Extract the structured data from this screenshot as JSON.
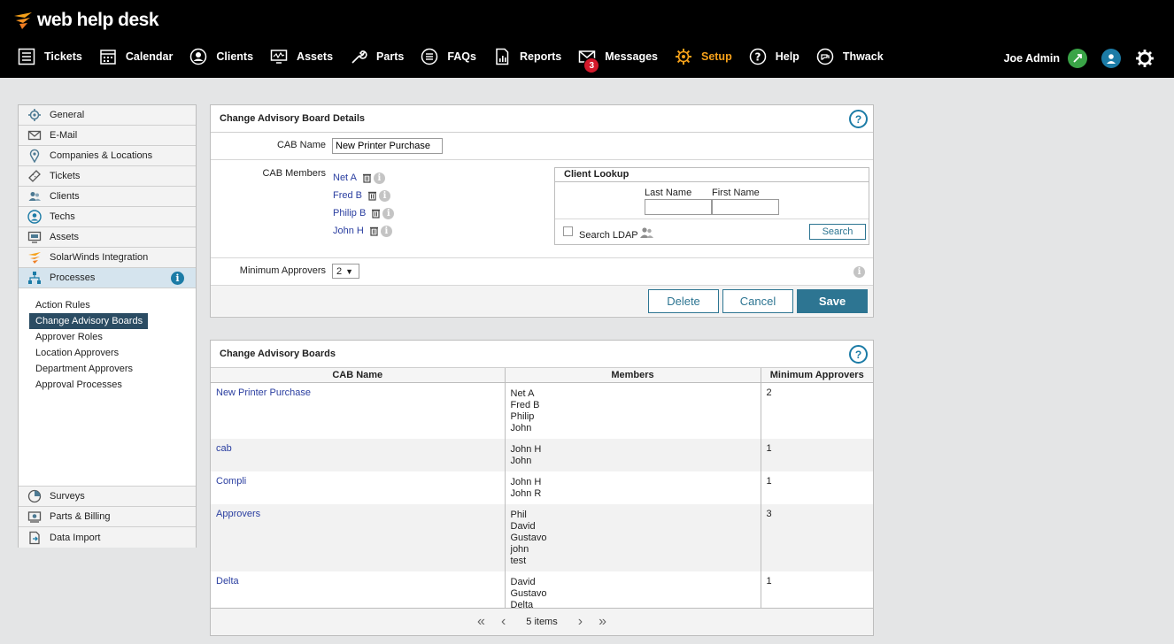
{
  "header": {
    "logo_text": "web help desk",
    "nav": [
      {
        "label": "Tickets",
        "icon": "list-icon"
      },
      {
        "label": "Calendar",
        "icon": "calendar-icon"
      },
      {
        "label": "Clients",
        "icon": "person-icon"
      },
      {
        "label": "Assets",
        "icon": "monitor-icon"
      },
      {
        "label": "Parts",
        "icon": "wrench-icon"
      },
      {
        "label": "FAQs",
        "icon": "faq-icon"
      },
      {
        "label": "Reports",
        "icon": "report-icon"
      },
      {
        "label": "Messages",
        "icon": "envelope-icon",
        "badge": "3"
      },
      {
        "label": "Setup",
        "icon": "gear-icon",
        "active": true
      },
      {
        "label": "Help",
        "icon": "question-icon"
      },
      {
        "label": "Thwack",
        "icon": "thwack-icon"
      }
    ],
    "user_name": "Joe Admin"
  },
  "sidebar": {
    "items": [
      {
        "label": "General"
      },
      {
        "label": "E-Mail"
      },
      {
        "label": "Companies & Locations"
      },
      {
        "label": "Tickets"
      },
      {
        "label": "Clients"
      },
      {
        "label": "Techs"
      },
      {
        "label": "Assets"
      },
      {
        "label": "SolarWinds Integration"
      },
      {
        "label": "Processes",
        "info": "i"
      }
    ],
    "subitems": [
      {
        "label": "Action Rules"
      },
      {
        "label": "Change Advisory Boards",
        "active": true
      },
      {
        "label": "Approver Roles"
      },
      {
        "label": "Location Approvers"
      },
      {
        "label": "Department Approvers"
      },
      {
        "label": "Approval Processes"
      }
    ],
    "bottom_items": [
      {
        "label": "Surveys"
      },
      {
        "label": "Parts & Billing"
      },
      {
        "label": "Data Import"
      }
    ]
  },
  "details": {
    "title": "Change Advisory Board Details",
    "help": "?",
    "cab_name_label": "CAB Name",
    "cab_name_value": "New Printer Purchase",
    "members_label": "CAB Members",
    "members": [
      "Net A",
      "Fred B",
      "Philip B",
      "John H"
    ],
    "lookup": {
      "title": "Client Lookup",
      "last_name_label": "Last Name",
      "first_name_label": "First Name",
      "search_ldap_label": "Search LDAP",
      "search_button": "Search"
    },
    "min_approvers_label": "Minimum Approvers",
    "min_approvers_value": "2",
    "delete_button": "Delete",
    "cancel_button": "Cancel",
    "save_button": "Save"
  },
  "boards": {
    "title": "Change Advisory Boards",
    "help": "?",
    "columns": [
      "CAB Name",
      "Members",
      "Minimum Approvers"
    ],
    "rows": [
      {
        "name": "New Printer Purchase",
        "members": [
          "Net A",
          "Fred B",
          "Philip",
          "John"
        ],
        "min": "2"
      },
      {
        "name": "cab",
        "members": [
          "John H",
          "John"
        ],
        "min": "1"
      },
      {
        "name": "Compli",
        "members": [
          "John H",
          "John R"
        ],
        "min": "1"
      },
      {
        "name": "Approvers",
        "members": [
          "Phil",
          "David",
          "Gustavo",
          "john",
          "test"
        ],
        "min": "3"
      },
      {
        "name": "Delta",
        "members": [
          "David",
          "Gustavo",
          "Delta"
        ],
        "min": "1"
      }
    ],
    "pager_text": "5 items"
  },
  "colors": {
    "accent": "#2d7592",
    "setup_active": "#f6a11a",
    "badge": "#d4192b",
    "link": "#2a3ea0"
  }
}
